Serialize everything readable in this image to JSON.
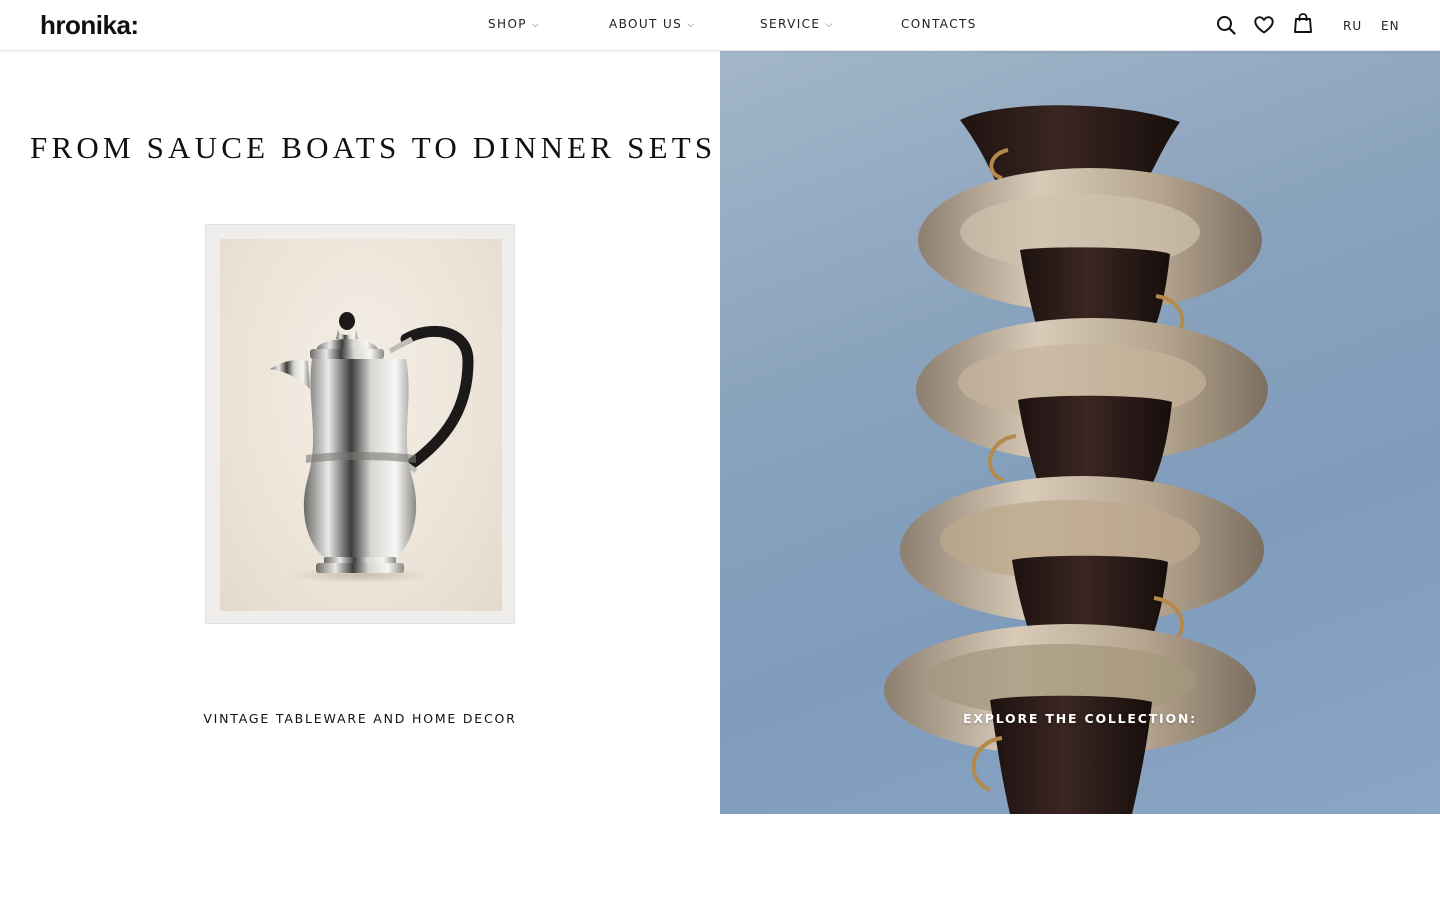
{
  "header": {
    "logo": "hronika:",
    "nav": [
      {
        "label": "SHOP",
        "has_dropdown": true
      },
      {
        "label": "ABOUT US",
        "has_dropdown": true
      },
      {
        "label": "SERVICE",
        "has_dropdown": true
      },
      {
        "label": "CONTACTS",
        "has_dropdown": false
      }
    ],
    "chevron": "⌵",
    "icons": [
      "search-icon",
      "heart-icon",
      "shopping-bag-icon"
    ],
    "languages": [
      "RU",
      "EN"
    ]
  },
  "hero": {
    "title": "FROM SAUCE BOATS TO DINNER SETS",
    "left_cta": "VINTAGE TABLEWARE AND HOME DECOR",
    "right_cta": "EXPLORE THE COLLECTION:"
  },
  "colors": {
    "background": "#ffffff",
    "text": "#111111",
    "sky_blue": "#8aa3bd",
    "cup_brown": "#2e1d1a",
    "saucer_cream": "#c9b8a3"
  }
}
